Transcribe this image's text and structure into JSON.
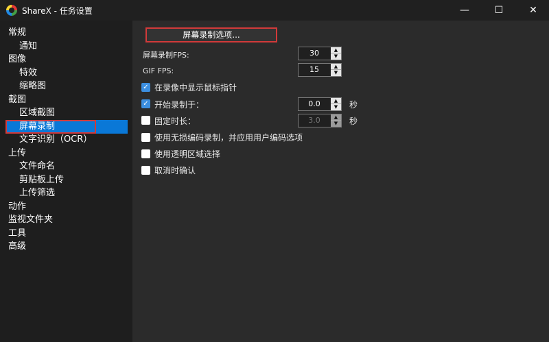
{
  "window": {
    "title": "ShareX - 任务设置",
    "controls": {
      "minimize": "—",
      "maximize": "☐",
      "close": "✕"
    }
  },
  "sidebar": {
    "items": [
      {
        "label": "常规"
      },
      {
        "label": "通知"
      },
      {
        "label": "图像"
      },
      {
        "label": "特效"
      },
      {
        "label": "缩略图"
      },
      {
        "label": "截图"
      },
      {
        "label": "区域截图"
      },
      {
        "label": "屏幕录制",
        "selected": true
      },
      {
        "label": "文字识别（OCR）"
      },
      {
        "label": "上传"
      },
      {
        "label": "文件命名"
      },
      {
        "label": "剪贴板上传"
      },
      {
        "label": "上传筛选"
      },
      {
        "label": "动作"
      },
      {
        "label": "监视文件夹"
      },
      {
        "label": "工具"
      },
      {
        "label": "高级"
      }
    ]
  },
  "main": {
    "screen_recording_options_button": "屏幕录制选项...",
    "screen_recording_fps": {
      "label": "屏幕录制FPS:",
      "value": "30"
    },
    "gif_fps": {
      "label": "GIF FPS:",
      "value": "15"
    },
    "show_cursor": {
      "label": "在录像中显示鼠标指针",
      "checked": true
    },
    "start_delay": {
      "label": "开始录制于：",
      "checked": true,
      "value": "0.0",
      "unit": "秒"
    },
    "fixed_duration": {
      "label": "固定时长：",
      "checked": false,
      "value": "3.0",
      "unit": "秒",
      "disabled": true
    },
    "lossless": {
      "label": "使用无损编码录制，并应用用户编码选项",
      "checked": false
    },
    "transparent_region": {
      "label": "使用透明区域选择",
      "checked": false
    },
    "confirm_cancel": {
      "label": "取消时确认",
      "checked": false
    }
  },
  "colors": {
    "accent": "#0a78d7",
    "highlight_box": "#d23a3a",
    "checkbox_checked": "#3c8fe0"
  }
}
